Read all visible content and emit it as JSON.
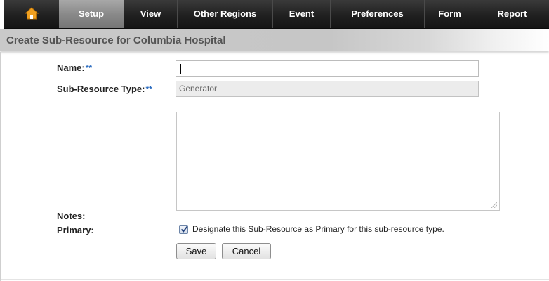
{
  "nav": {
    "items": [
      {
        "id": "home",
        "label": "",
        "icon": "home-icon"
      },
      {
        "id": "setup",
        "label": "Setup",
        "active": true
      },
      {
        "id": "view",
        "label": "View"
      },
      {
        "id": "other_regions",
        "label": "Other Regions"
      },
      {
        "id": "event",
        "label": "Event"
      },
      {
        "id": "preferences",
        "label": "Preferences"
      },
      {
        "id": "form",
        "label": "Form"
      },
      {
        "id": "report",
        "label": "Report"
      }
    ]
  },
  "page": {
    "title": "Create Sub-Resource for Columbia Hospital"
  },
  "form": {
    "name_label": "Name:",
    "required_marker": "**",
    "name_value": "",
    "type_label": "Sub-Resource Type:",
    "type_value": "Generator",
    "notes_label": "Notes:",
    "notes_value": "",
    "primary_label": "Primary:",
    "primary_checked": true,
    "primary_text": "Designate this Sub-Resource as Primary for this sub-resource type.",
    "save_label": "Save",
    "cancel_label": "Cancel"
  },
  "colors": {
    "nav_bg": "#1e1e1e",
    "nav_active": "#8a8a8a",
    "home_icon": "#f0a020",
    "required_marker": "#2b6cc0",
    "title_text": "#555555"
  }
}
